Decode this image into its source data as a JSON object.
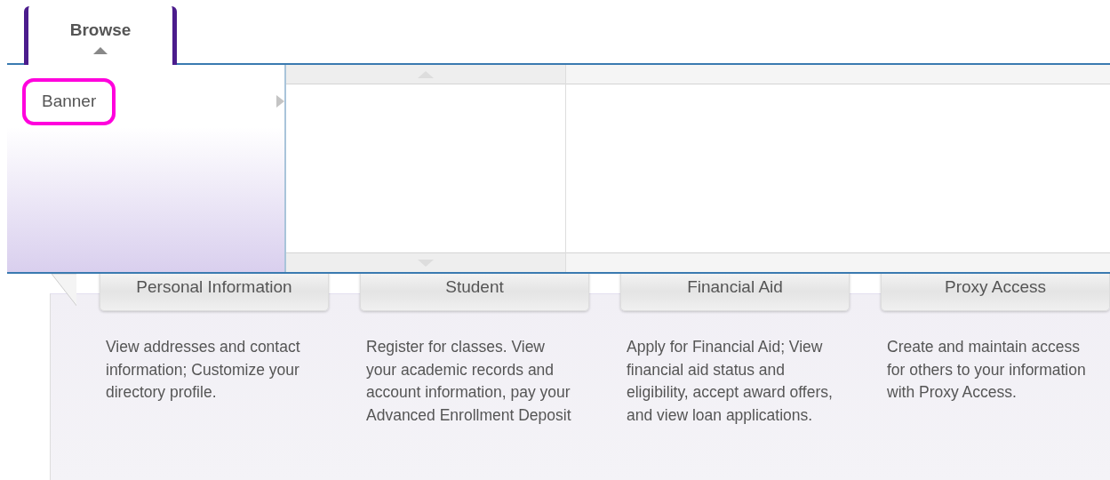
{
  "tabs": [
    {
      "label": "Browse",
      "selected": true
    }
  ],
  "browse_menu": {
    "items": [
      {
        "label": "Banner",
        "highlighted": true,
        "has_submenu": true
      }
    ]
  },
  "categories": [
    {
      "title": "Personal Information",
      "description": "View addresses and contact information; Customize your directory profile."
    },
    {
      "title": "Student",
      "description": "Register for classes. View your academic records and account information, pay your Advanced Enrollment Deposit"
    },
    {
      "title": "Financial Aid",
      "description": "Apply for Financial Aid; View financial aid status and eligibility, accept award offers, and view loan applications."
    },
    {
      "title": "Proxy Access",
      "description": "Create and maintain access for others to your information with Proxy Access."
    }
  ]
}
